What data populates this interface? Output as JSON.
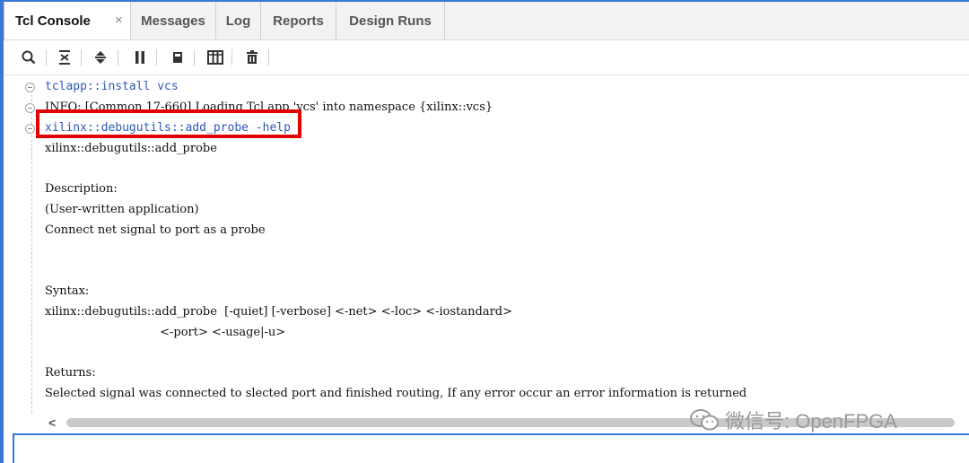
{
  "tabs": [
    {
      "label": "Tcl Console",
      "close": "×"
    },
    {
      "label": "Messages"
    },
    {
      "label": "Log"
    },
    {
      "label": "Reports"
    },
    {
      "label": "Design Runs"
    }
  ],
  "toolbar": {
    "icons": [
      "search-icon",
      "collapse-all-icon",
      "expand-all-icon",
      "pause-icon",
      "copy-icon",
      "columns-icon",
      "clear-icon"
    ]
  },
  "console": {
    "lines": [
      "tclapp::install vcs",
      "INFO: [Common 17-660] Loading Tcl app 'vcs' into namespace {xilinx::vcs}",
      "xilinx::debugutils::add_probe -help",
      "xilinx::debugutils::add_probe",
      "Description:",
      "(User-written application)",
      "Connect net signal to port as a probe",
      "Syntax:",
      "xilinx::debugutils::add_probe  [-quiet] [-verbose] <-net> <-loc> <-iostandard>",
      "                               <-port> <-usage|-u>",
      "Returns:",
      "Selected signal was connected to slected port and finished routing, If any error occur an error information is returned"
    ]
  },
  "scroll": {
    "left_arrow": "<"
  },
  "watermark": {
    "text": "微信号: OpenFPGA"
  },
  "colors": {
    "accent": "#3a78d4",
    "command": "#2f59b8",
    "highlight": "#e00000"
  }
}
